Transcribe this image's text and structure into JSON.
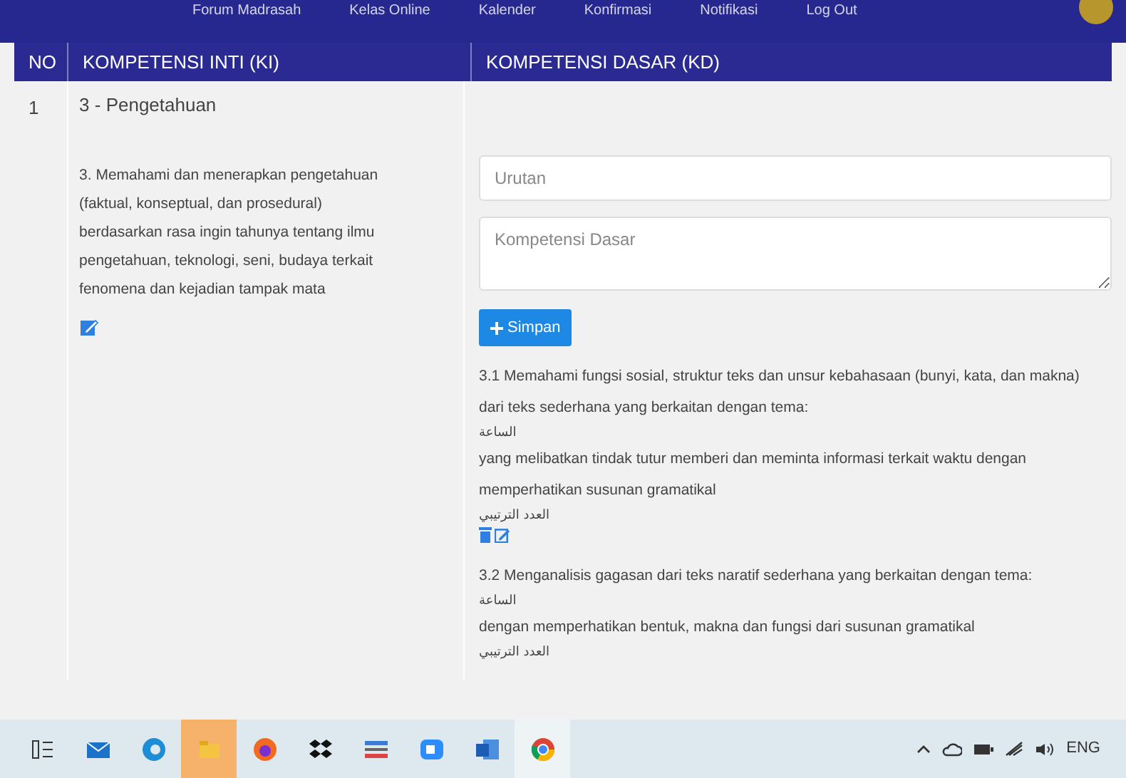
{
  "nav": {
    "items": [
      "Forum Madrasah",
      "Kelas Online",
      "Kalender",
      "Konfirmasi",
      "Notifikasi",
      "Log Out"
    ]
  },
  "table": {
    "columns": [
      "NO",
      "KOMPETENSI INTI (KI)",
      "KOMPETENSI DASAR (KD)"
    ],
    "rows": [
      {
        "no": "1",
        "ki_title": "3 - Pengetahuan",
        "ki_text": "3. Memahami dan menerapkan pengetahuan (faktual, konseptual, dan prosedural) berdasarkan rasa ingin tahunya tentang ilmu pengetahuan, teknologi, seni, budaya terkait fenomena dan kejadian tampak mata",
        "form": {
          "order_placeholder": "Urutan",
          "kd_placeholder": "Kompetensi Dasar",
          "save_label": "Simpan"
        },
        "kd_items": [
          {
            "parts": [
              {
                "kind": "text",
                "text": "3.1 Memahami fungsi sosial, struktur teks dan unsur kebahasaan (bunyi, kata, dan makna) dari teks sederhana yang berkaitan dengan tema:"
              },
              {
                "kind": "arabic",
                "text": "الساعة"
              },
              {
                "kind": "text",
                "text": "yang melibatkan tindak tutur memberi dan meminta informasi terkait waktu dengan memperhatikan susunan gramatikal"
              },
              {
                "kind": "arabic",
                "text": "العدد الترتيبي"
              }
            ],
            "actions": true
          },
          {
            "parts": [
              {
                "kind": "text",
                "text": "3.2 Menganalisis gagasan dari teks naratif sederhana yang berkaitan dengan tema:"
              },
              {
                "kind": "arabic",
                "text": "الساعة"
              },
              {
                "kind": "text",
                "text": "dengan memperhatikan bentuk, makna dan fungsi dari susunan gramatikal"
              },
              {
                "kind": "arabic",
                "text": "العدد الترتيبي"
              }
            ],
            "actions": false
          }
        ]
      }
    ]
  },
  "taskbar": {
    "language": "ENG"
  }
}
